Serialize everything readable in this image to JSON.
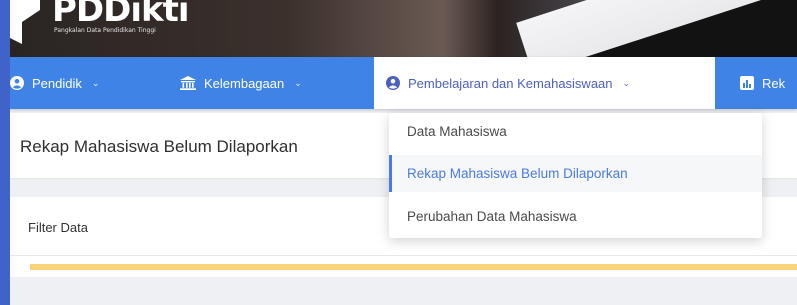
{
  "header": {
    "logo_title": "PDDikti",
    "logo_subtitle": "Pangkalan Data Pendidikan Tinggi"
  },
  "nav": {
    "items": [
      {
        "label": "Pendidik",
        "icon": "user-circle-icon"
      },
      {
        "label": "Kelembagaan",
        "icon": "institution-icon"
      },
      {
        "label": "Pembelajaran dan Kemahasiswaan",
        "icon": "user-circle-icon"
      },
      {
        "label": "Rek",
        "icon": "chart-icon"
      }
    ]
  },
  "dropdown": {
    "items": [
      {
        "label": "Data Mahasiswa"
      },
      {
        "label": "Rekap Mahasiswa Belum Dilaporkan"
      },
      {
        "label": "Perubahan Data Mahasiswa"
      }
    ],
    "selected_index": 1
  },
  "page": {
    "title": "Rekap Mahasiswa Belum Dilaporkan"
  },
  "filter": {
    "label": "Filter Data",
    "progress_fraction": 1.0
  },
  "colors": {
    "nav_bg": "#3f83e6",
    "accent": "#4a7be0",
    "outer_bg": "#3f63c9",
    "progress": "#f9d27b"
  }
}
